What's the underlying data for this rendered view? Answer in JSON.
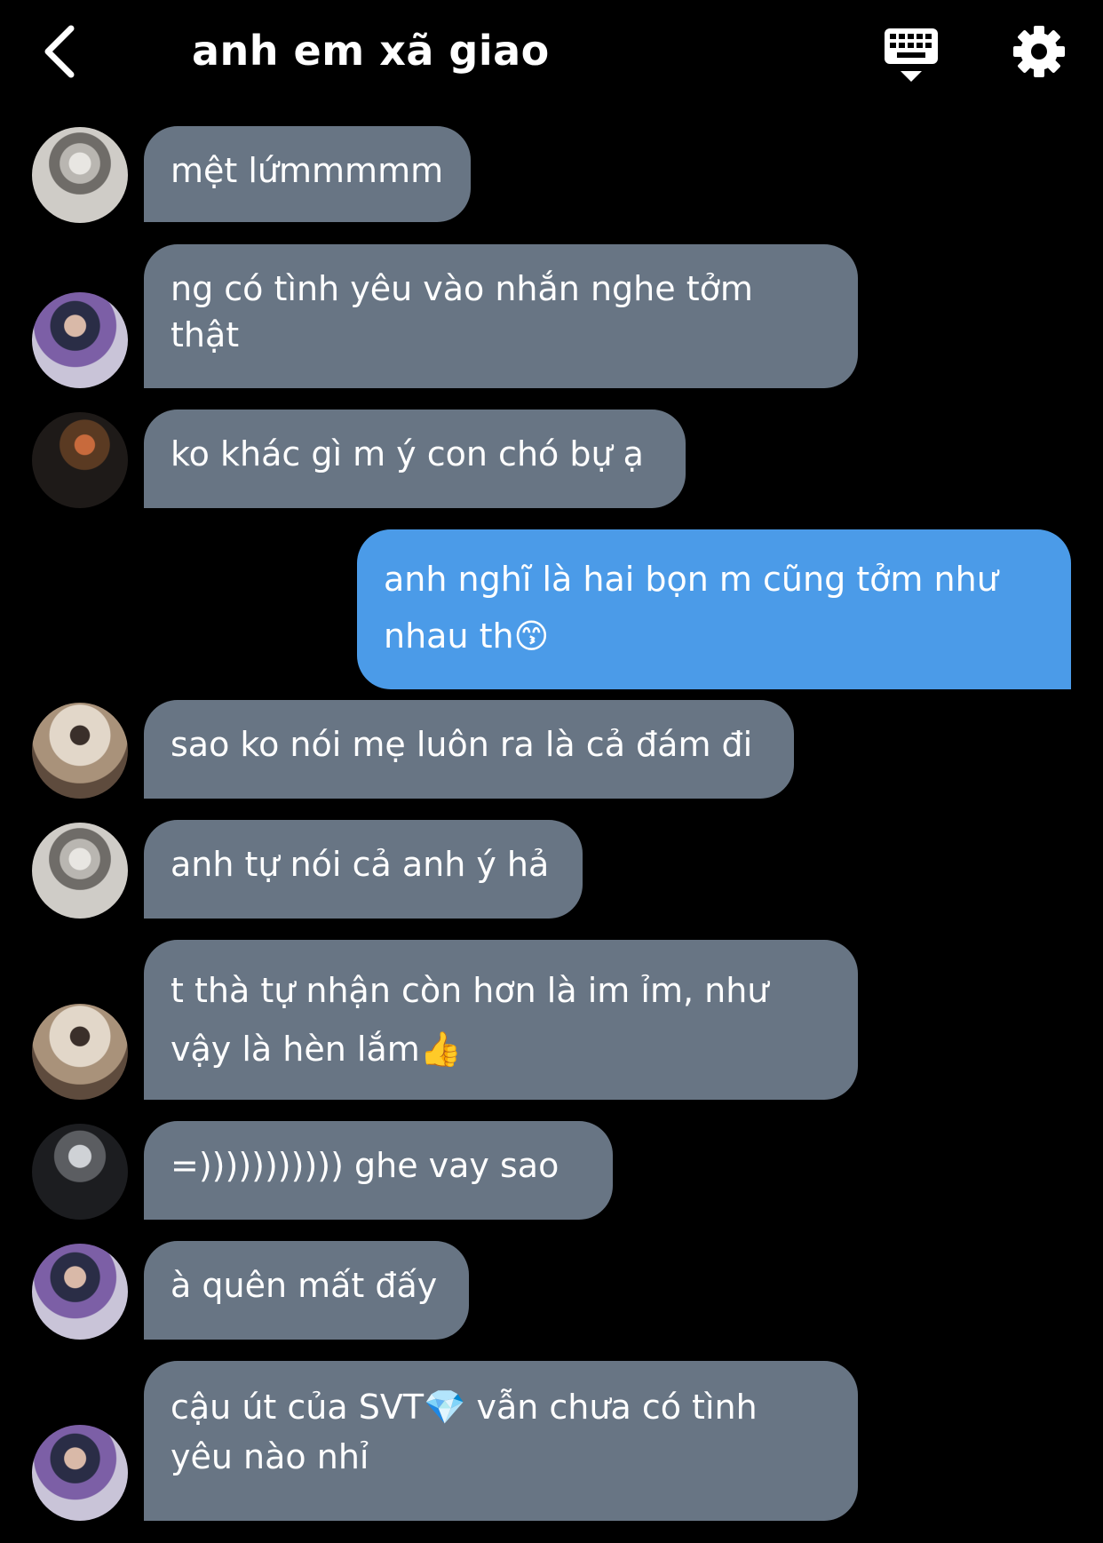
{
  "header": {
    "title": "anh em xã giao",
    "back_icon": "chevron-left-icon",
    "keyboard_icon": "keyboard-icon",
    "settings_icon": "gear-icon"
  },
  "colors": {
    "background": "#000000",
    "incoming_bubble": "#687584",
    "outgoing_bubble": "#4b9be8",
    "text": "#ffffff"
  },
  "messages": [
    {
      "text": "mệt lứmmmmm",
      "from": "member"
    },
    {
      "text": "ng có tình yêu vào nhắn nghe tởm\nthật",
      "from": "member"
    },
    {
      "text": "ko khác gì m ý con chó bự ạ",
      "from": "member"
    },
    {
      "text": "anh nghĩ là hai bọn m cũng tởm như\nnhau th😙",
      "from": "me"
    },
    {
      "text": "sao ko nói mẹ luôn ra là cả đám đi",
      "from": "member"
    },
    {
      "text": "anh tự nói cả anh ý hả",
      "from": "member"
    },
    {
      "text": "t thà tự nhận còn hơn là im ỉm, như\nvậy là hèn lắm👍",
      "from": "member"
    },
    {
      "text": "=))))))))))) ghe vay sao",
      "from": "member"
    },
    {
      "text": "à quên mất đấy",
      "from": "member"
    },
    {
      "text": "cậu út của SVT💎 vẫn chưa có tình\nyêu nào nhỉ",
      "from": "member"
    }
  ]
}
